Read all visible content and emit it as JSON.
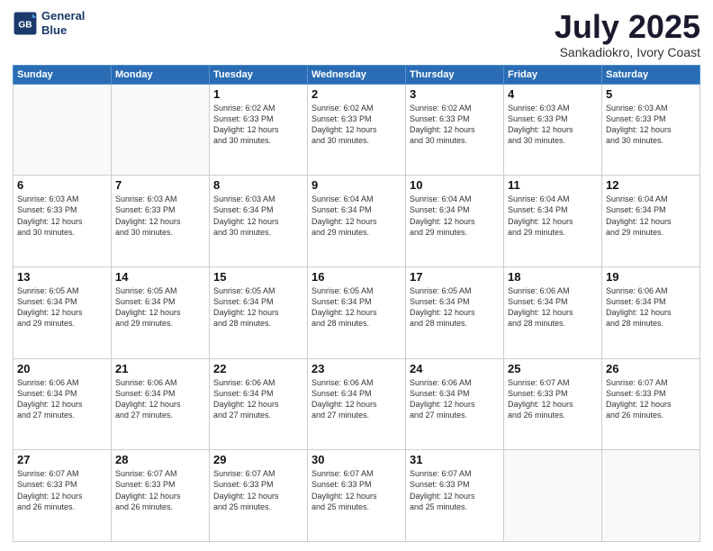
{
  "header": {
    "logo_line1": "General",
    "logo_line2": "Blue",
    "month": "July 2025",
    "location": "Sankadiokro, Ivory Coast"
  },
  "weekdays": [
    "Sunday",
    "Monday",
    "Tuesday",
    "Wednesday",
    "Thursday",
    "Friday",
    "Saturday"
  ],
  "weeks": [
    [
      {
        "day": "",
        "info": ""
      },
      {
        "day": "",
        "info": ""
      },
      {
        "day": "1",
        "info": "Sunrise: 6:02 AM\nSunset: 6:33 PM\nDaylight: 12 hours\nand 30 minutes."
      },
      {
        "day": "2",
        "info": "Sunrise: 6:02 AM\nSunset: 6:33 PM\nDaylight: 12 hours\nand 30 minutes."
      },
      {
        "day": "3",
        "info": "Sunrise: 6:02 AM\nSunset: 6:33 PM\nDaylight: 12 hours\nand 30 minutes."
      },
      {
        "day": "4",
        "info": "Sunrise: 6:03 AM\nSunset: 6:33 PM\nDaylight: 12 hours\nand 30 minutes."
      },
      {
        "day": "5",
        "info": "Sunrise: 6:03 AM\nSunset: 6:33 PM\nDaylight: 12 hours\nand 30 minutes."
      }
    ],
    [
      {
        "day": "6",
        "info": "Sunrise: 6:03 AM\nSunset: 6:33 PM\nDaylight: 12 hours\nand 30 minutes."
      },
      {
        "day": "7",
        "info": "Sunrise: 6:03 AM\nSunset: 6:33 PM\nDaylight: 12 hours\nand 30 minutes."
      },
      {
        "day": "8",
        "info": "Sunrise: 6:03 AM\nSunset: 6:34 PM\nDaylight: 12 hours\nand 30 minutes."
      },
      {
        "day": "9",
        "info": "Sunrise: 6:04 AM\nSunset: 6:34 PM\nDaylight: 12 hours\nand 29 minutes."
      },
      {
        "day": "10",
        "info": "Sunrise: 6:04 AM\nSunset: 6:34 PM\nDaylight: 12 hours\nand 29 minutes."
      },
      {
        "day": "11",
        "info": "Sunrise: 6:04 AM\nSunset: 6:34 PM\nDaylight: 12 hours\nand 29 minutes."
      },
      {
        "day": "12",
        "info": "Sunrise: 6:04 AM\nSunset: 6:34 PM\nDaylight: 12 hours\nand 29 minutes."
      }
    ],
    [
      {
        "day": "13",
        "info": "Sunrise: 6:05 AM\nSunset: 6:34 PM\nDaylight: 12 hours\nand 29 minutes."
      },
      {
        "day": "14",
        "info": "Sunrise: 6:05 AM\nSunset: 6:34 PM\nDaylight: 12 hours\nand 29 minutes."
      },
      {
        "day": "15",
        "info": "Sunrise: 6:05 AM\nSunset: 6:34 PM\nDaylight: 12 hours\nand 28 minutes."
      },
      {
        "day": "16",
        "info": "Sunrise: 6:05 AM\nSunset: 6:34 PM\nDaylight: 12 hours\nand 28 minutes."
      },
      {
        "day": "17",
        "info": "Sunrise: 6:05 AM\nSunset: 6:34 PM\nDaylight: 12 hours\nand 28 minutes."
      },
      {
        "day": "18",
        "info": "Sunrise: 6:06 AM\nSunset: 6:34 PM\nDaylight: 12 hours\nand 28 minutes."
      },
      {
        "day": "19",
        "info": "Sunrise: 6:06 AM\nSunset: 6:34 PM\nDaylight: 12 hours\nand 28 minutes."
      }
    ],
    [
      {
        "day": "20",
        "info": "Sunrise: 6:06 AM\nSunset: 6:34 PM\nDaylight: 12 hours\nand 27 minutes."
      },
      {
        "day": "21",
        "info": "Sunrise: 6:06 AM\nSunset: 6:34 PM\nDaylight: 12 hours\nand 27 minutes."
      },
      {
        "day": "22",
        "info": "Sunrise: 6:06 AM\nSunset: 6:34 PM\nDaylight: 12 hours\nand 27 minutes."
      },
      {
        "day": "23",
        "info": "Sunrise: 6:06 AM\nSunset: 6:34 PM\nDaylight: 12 hours\nand 27 minutes."
      },
      {
        "day": "24",
        "info": "Sunrise: 6:06 AM\nSunset: 6:34 PM\nDaylight: 12 hours\nand 27 minutes."
      },
      {
        "day": "25",
        "info": "Sunrise: 6:07 AM\nSunset: 6:33 PM\nDaylight: 12 hours\nand 26 minutes."
      },
      {
        "day": "26",
        "info": "Sunrise: 6:07 AM\nSunset: 6:33 PM\nDaylight: 12 hours\nand 26 minutes."
      }
    ],
    [
      {
        "day": "27",
        "info": "Sunrise: 6:07 AM\nSunset: 6:33 PM\nDaylight: 12 hours\nand 26 minutes."
      },
      {
        "day": "28",
        "info": "Sunrise: 6:07 AM\nSunset: 6:33 PM\nDaylight: 12 hours\nand 26 minutes."
      },
      {
        "day": "29",
        "info": "Sunrise: 6:07 AM\nSunset: 6:33 PM\nDaylight: 12 hours\nand 25 minutes."
      },
      {
        "day": "30",
        "info": "Sunrise: 6:07 AM\nSunset: 6:33 PM\nDaylight: 12 hours\nand 25 minutes."
      },
      {
        "day": "31",
        "info": "Sunrise: 6:07 AM\nSunset: 6:33 PM\nDaylight: 12 hours\nand 25 minutes."
      },
      {
        "day": "",
        "info": ""
      },
      {
        "day": "",
        "info": ""
      }
    ]
  ]
}
